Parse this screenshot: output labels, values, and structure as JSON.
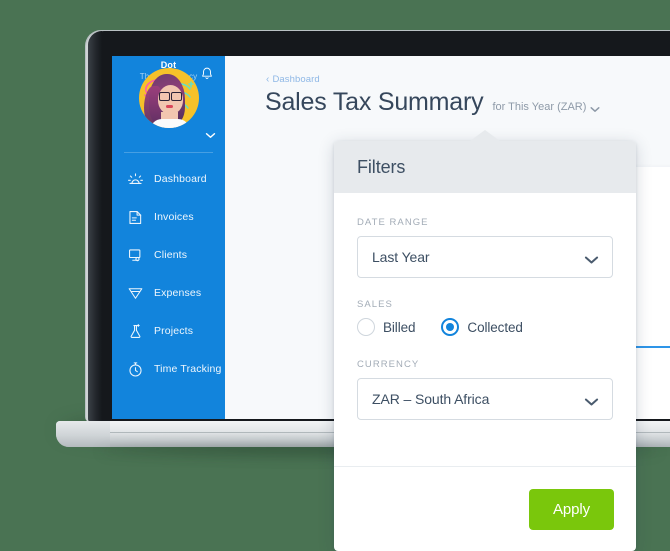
{
  "app": {
    "sidebar": {
      "bell_icon": "bell-icon",
      "user": {
        "name": "Dot",
        "org": "The Ant Agency",
        "caret_icon": "chevron-down-icon",
        "avatar_icon": "avatar"
      },
      "items": [
        {
          "label": "Dashboard",
          "icon": "dashboard-sun-icon"
        },
        {
          "label": "Invoices",
          "icon": "invoice-document-icon"
        },
        {
          "label": "Clients",
          "icon": "clients-monitor-icon"
        },
        {
          "label": "Expenses",
          "icon": "expenses-funnel-icon"
        },
        {
          "label": "Projects",
          "icon": "projects-flask-icon"
        },
        {
          "label": "Time Tracking",
          "icon": "stopwatch-icon"
        }
      ]
    },
    "header": {
      "breadcrumb": "Dashboard",
      "breadcrumb_chevron": "chevron-left-icon",
      "title": "Sales Tax Summary",
      "subtitle": "for This Year (ZAR)",
      "subtitle_caret": "chevron-down-icon"
    }
  },
  "filters": {
    "title": "Filters",
    "date_range": {
      "label": "DATE RANGE",
      "value": "Last Year",
      "caret_icon": "chevron-down-icon"
    },
    "sales": {
      "label": "SALES",
      "options": [
        {
          "label": "Billed",
          "selected": false
        },
        {
          "label": "Collected",
          "selected": true
        }
      ]
    },
    "currency": {
      "label": "CURRENCY",
      "value": "ZAR – South Africa",
      "caret_icon": "chevron-down-icon"
    },
    "apply_label": "Apply"
  },
  "colors": {
    "background": "#4a7353",
    "sidebar": "#1284dc",
    "accent": "#1284dc",
    "apply_green": "#7ac70c",
    "title_text": "#36475c",
    "panel_header": "#e7eaed"
  }
}
